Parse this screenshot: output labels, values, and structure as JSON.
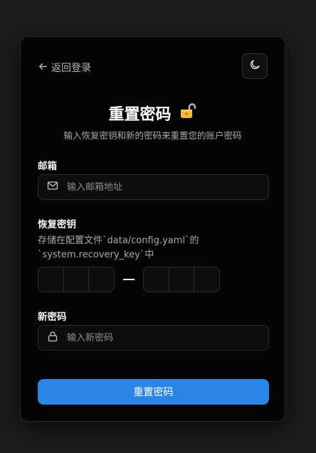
{
  "header": {
    "back_label": "返回登录",
    "theme_toggle_icon": "moon-icon"
  },
  "title": {
    "text": "重置密码",
    "emoji_icon": "unlocked-padlock-icon"
  },
  "subtitle": "输入恢复密钥和新的密码来重置您的账户密码",
  "email": {
    "label": "邮箱",
    "placeholder": "输入邮箱地址",
    "value": "",
    "icon": "mail-icon"
  },
  "recovery": {
    "label": "恢复密钥",
    "hint": "存储在配置文件`data/config.yaml`的`system.recovery_key`中",
    "group1": [
      "",
      "",
      ""
    ],
    "group2": [
      "",
      "",
      ""
    ]
  },
  "new_password": {
    "label": "新密码",
    "placeholder": "输入新密码",
    "value": "",
    "icon": "lock-icon"
  },
  "submit_label": "重置密码",
  "colors": {
    "page_bg": "#1b1b1b",
    "card_bg": "#050505",
    "accent": "#2b85e4"
  }
}
